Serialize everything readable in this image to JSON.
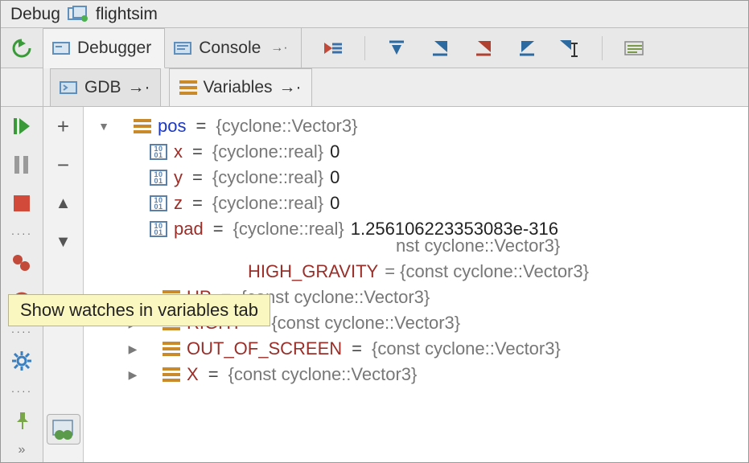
{
  "title": {
    "view": "Debug",
    "project": "flightsim"
  },
  "top_tabs": {
    "debugger": "Debugger",
    "console": "Console"
  },
  "sub_tabs": {
    "gdb": "GDB",
    "variables": "Variables"
  },
  "tooltip": "Show watches in variables tab",
  "tree": {
    "root": {
      "name": "pos",
      "type": "{cyclone::Vector3}"
    },
    "fields": [
      {
        "name": "x",
        "type": "{cyclone::real}",
        "value": "0"
      },
      {
        "name": "y",
        "type": "{cyclone::real}",
        "value": "0"
      },
      {
        "name": "z",
        "type": "{cyclone::real}",
        "value": "0"
      },
      {
        "name": "pad",
        "type": "{cyclone::real}",
        "value": "1.256106223353083e-316"
      }
    ],
    "siblings": [
      {
        "name_fragment_left": "",
        "name_fragment_right": "",
        "full_tail": "nst cyclone::Vector3}"
      },
      {
        "name": "HIGH_GRAVITY",
        "partial_tail": " = {const cyclone::Vector3}"
      },
      {
        "name": "UP",
        "type": "{const cyclone::Vector3}"
      },
      {
        "name": "RIGHT",
        "type": "{const cyclone::Vector3}"
      },
      {
        "name": "OUT_OF_SCREEN",
        "type": "{const cyclone::Vector3}"
      },
      {
        "name": "X",
        "type": "{const cyclone::Vector3}"
      }
    ]
  },
  "eq": " = "
}
